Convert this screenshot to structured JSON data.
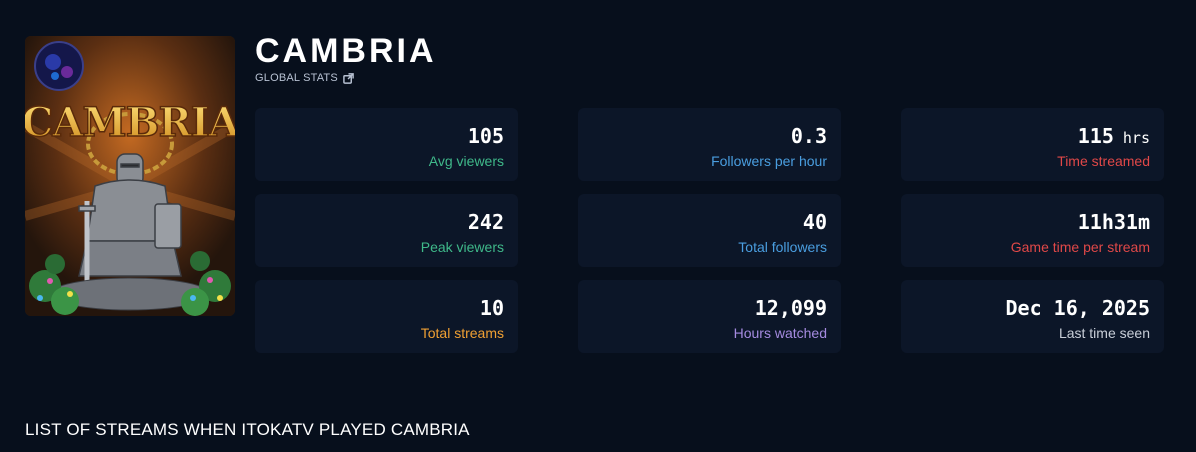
{
  "game": {
    "title": "CAMBRIA",
    "cover_logo_text": "CAMBRIA",
    "global_stats_label": "GLOBAL STATS",
    "global_stats_icon": "external-link-icon"
  },
  "stats": [
    {
      "key": "avg-viewers",
      "value": "105",
      "unit": "",
      "label": "Avg viewers",
      "color": "#3fb98a"
    },
    {
      "key": "followers-per-hour",
      "value": "0.3",
      "unit": "",
      "label": "Followers per hour",
      "color": "#4a9ee0"
    },
    {
      "key": "time-streamed",
      "value": "115",
      "unit": " hrs",
      "label": "Time streamed",
      "color": "#e04848"
    },
    {
      "key": "peak-viewers",
      "value": "242",
      "unit": "",
      "label": "Peak viewers",
      "color": "#3fb98a"
    },
    {
      "key": "total-followers",
      "value": "40",
      "unit": "",
      "label": "Total followers",
      "color": "#4a9ee0"
    },
    {
      "key": "game-time-per-stream",
      "value": "11h31m",
      "unit": "",
      "label": "Game time per stream",
      "color": "#e04848"
    },
    {
      "key": "total-streams",
      "value": "10",
      "unit": "",
      "label": "Total streams",
      "color": "#f0a033"
    },
    {
      "key": "hours-watched",
      "value": "12,099",
      "unit": "",
      "label": "Hours watched",
      "color": "#a58be0"
    },
    {
      "key": "last-time-seen",
      "value": "Dec 16, 2025",
      "unit": "",
      "label": "Last time seen",
      "color": "#c8ced8"
    }
  ],
  "streams_section": {
    "title": "LIST OF STREAMS WHEN ITOKATV PLAYED CAMBRIA"
  }
}
